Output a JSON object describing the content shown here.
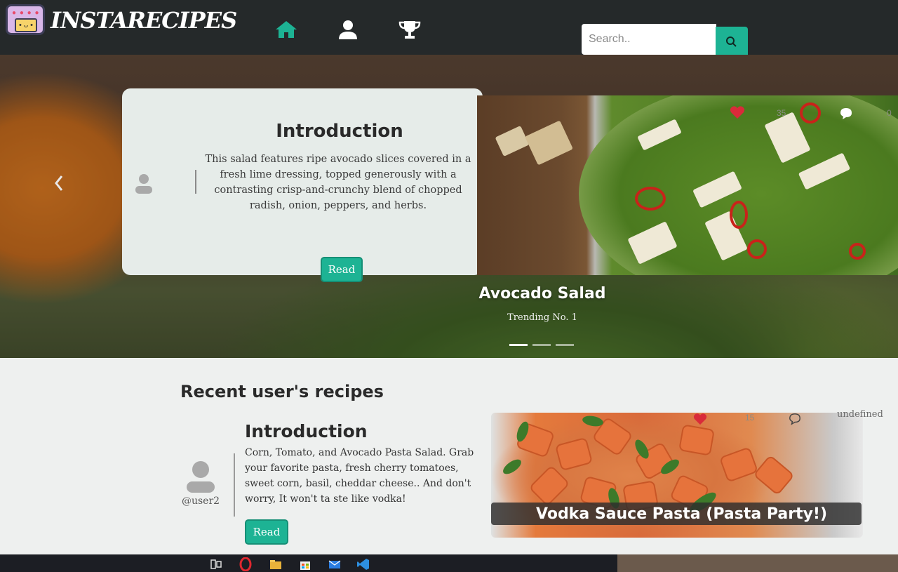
{
  "app": {
    "brand": "INSTARECIPES"
  },
  "nav": {
    "items": [
      {
        "name": "home",
        "active": true,
        "icon": "home-icon"
      },
      {
        "name": "profile",
        "active": false,
        "icon": "user-icon"
      },
      {
        "name": "leaderboard",
        "active": false,
        "icon": "trophy-icon"
      }
    ],
    "search_placeholder": "Search..",
    "search_icon": "search-icon"
  },
  "hero": {
    "card_title": "Introduction",
    "card_text": "This salad features ripe avocado slices covered in a fresh lime dressing, topped generously with a contrasting crisp-and-crunchy blend of chopped radish, onion, peppers, and herbs.",
    "read_label": "Read",
    "likes": "35",
    "comments": "0",
    "slide_title": "Avocado Salad",
    "slide_subtitle": "Trending No. 1",
    "slides_count": 3,
    "active_slide": 0
  },
  "recent": {
    "heading": "Recent user's recipes",
    "user": "@user2",
    "title": "Introduction",
    "text": "Corn, Tomato, and Avocado Pasta Salad. Grab your favorite pasta, fresh cherry tomatoes, sweet corn, basil, cheddar cheese.. And don't worry, It won't ta ste like vodka!",
    "read_label": "Read",
    "likes": "15",
    "comments": "undefined",
    "recipe_name": "Vodka Sauce Pasta (Pasta Party!)"
  },
  "colors": {
    "accent": "#1db394",
    "navbar": "#25292a",
    "heart": "#d92b3a"
  }
}
